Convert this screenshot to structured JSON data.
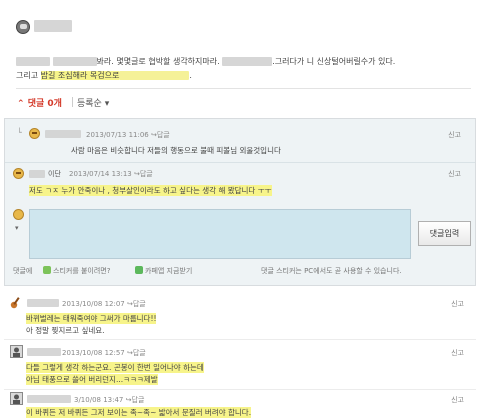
{
  "post": {
    "line1_visible": "봐라. 몇몇글로 협박할 생각하지마라.",
    "line1_tail": ".그러다가 니 신상털어버릴수가 있다.",
    "line2_start": "그리고 ",
    "line2_highlight": "밤길 조심해라 목검으로",
    "line2_end": ".",
    "comment_label": "댓글",
    "comment_count": "0개",
    "sort_label": "등록순"
  },
  "thread": {
    "comment1": {
      "date": "2013/07/13 11:06",
      "reply": "답글",
      "report": "신고",
      "text": "사람 마음은 비슷합니다 저들의 행동으로 불때 피볼님 외울것입니다"
    },
    "comment2": {
      "author_suffix": "이단",
      "date": "2013/07/14 13:13",
      "reply": "답글",
      "report": "신고",
      "text": "저도 ㄱㅈ       누가 안죽이나 , 청부살인이라도 하고 싶다는 생각 해 봤답니다 ㅜㅜ"
    },
    "input": {
      "value": "",
      "submit_label": "댓글입력"
    },
    "tools": {
      "left_label": "댓글에",
      "sticker_label": "스티커를 붙이려면?",
      "cafe_label": "카페앱 지금받기",
      "right_label": "댓글 스티커는 PC에서도 곧 사용할 수 있습니다."
    }
  },
  "list": [
    {
      "date": "2013/10/08 12:07",
      "reply": "답글",
      "report": "신고",
      "line1": "바뀌벌레는 태워죽여야 그써가 마룹니다!!",
      "line2": "아 정말 찢지르고 싶네요."
    },
    {
      "date": "2013/10/08 12:57",
      "reply": "답글",
      "report": "신고",
      "line1": "다들 그렇게 생각 하는군요. 곤봉이 한번 일어나야 하는데",
      "line2": "아님 태풍으로 쓸어 버리던지...ㅋㅋㅋ제발"
    },
    {
      "date": "3/10/08 13:47",
      "reply": "답글",
      "report": "신고",
      "line1": "이 바퀴든 저 바퀴든 그저 보이는 족~족~ 밟아서 문질러 버려야 합니다."
    }
  ],
  "colors": {
    "highlight": "#f7f48a",
    "accent_red": "#d43a2a",
    "input_bg": "#cfe6ee"
  }
}
